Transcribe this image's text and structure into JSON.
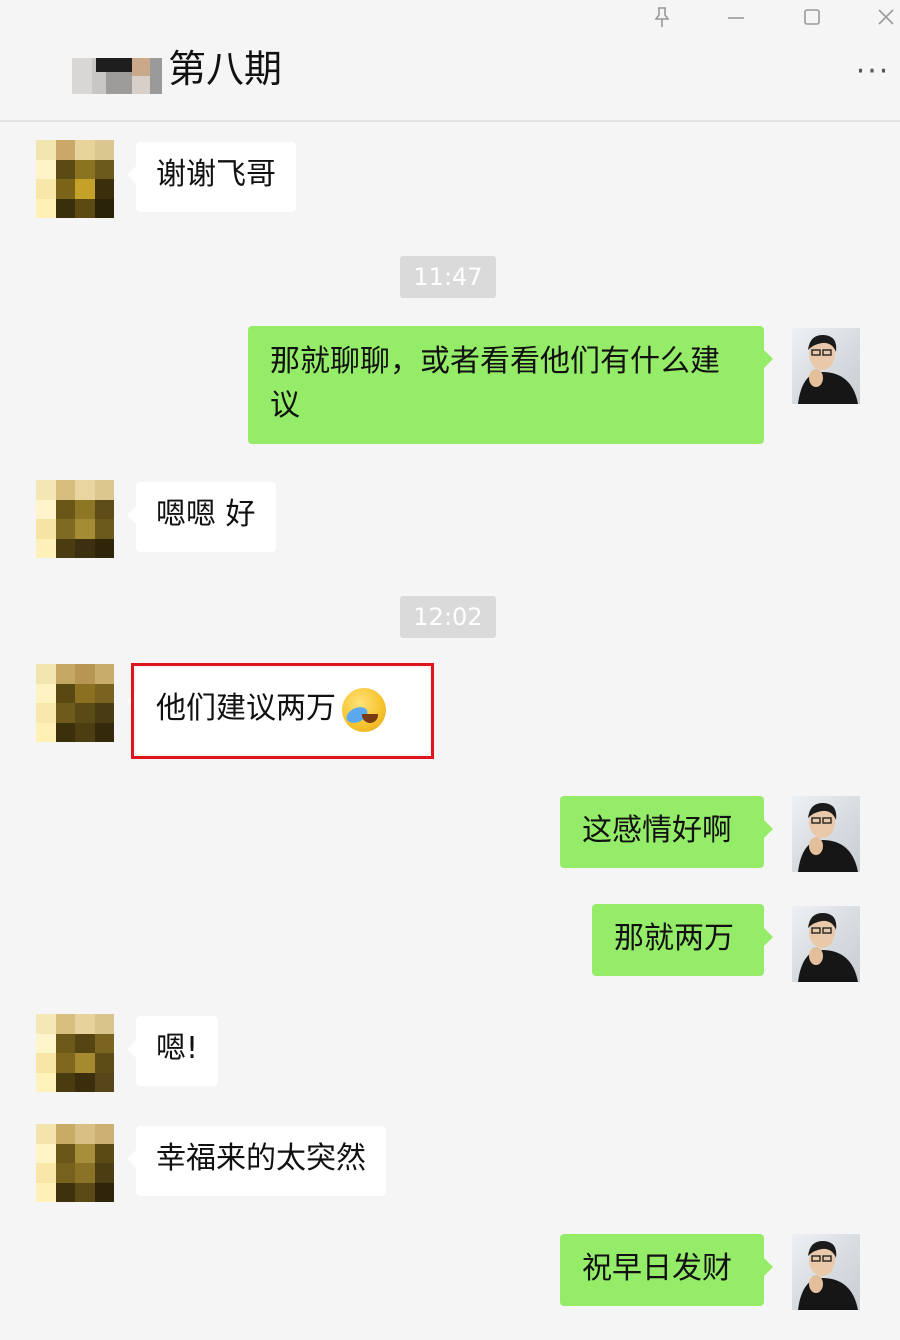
{
  "window": {
    "title": "第八期",
    "pin_icon": "pin-icon",
    "minimize_icon": "minimize-icon",
    "maximize_icon": "maximize-icon",
    "close_icon": "close-icon",
    "more_label": "···"
  },
  "messages": [
    {
      "side": "in",
      "text": "谢谢飞哥"
    },
    {
      "type": "time",
      "text": "11:47"
    },
    {
      "side": "out",
      "text": "那就聊聊，或者看看他们有什么建议"
    },
    {
      "side": "in",
      "text": "嗯嗯 好"
    },
    {
      "type": "time",
      "text": "12:02"
    },
    {
      "side": "in",
      "text": "他们建议两万",
      "emoji": "crying-laughing-emoji",
      "highlighted": true
    },
    {
      "side": "out",
      "text": "这感情好啊"
    },
    {
      "side": "out",
      "text": "那就两万"
    },
    {
      "side": "in",
      "text": "嗯!"
    },
    {
      "side": "in",
      "text": "幸福来的太突然"
    },
    {
      "side": "out",
      "text": "祝早日发财"
    }
  ],
  "colors": {
    "background": "#f5f5f5",
    "incoming_bubble": "#ffffff",
    "outgoing_bubble": "#95ec69",
    "timestamp_bg": "#dadada",
    "highlight": "#e0141e"
  }
}
